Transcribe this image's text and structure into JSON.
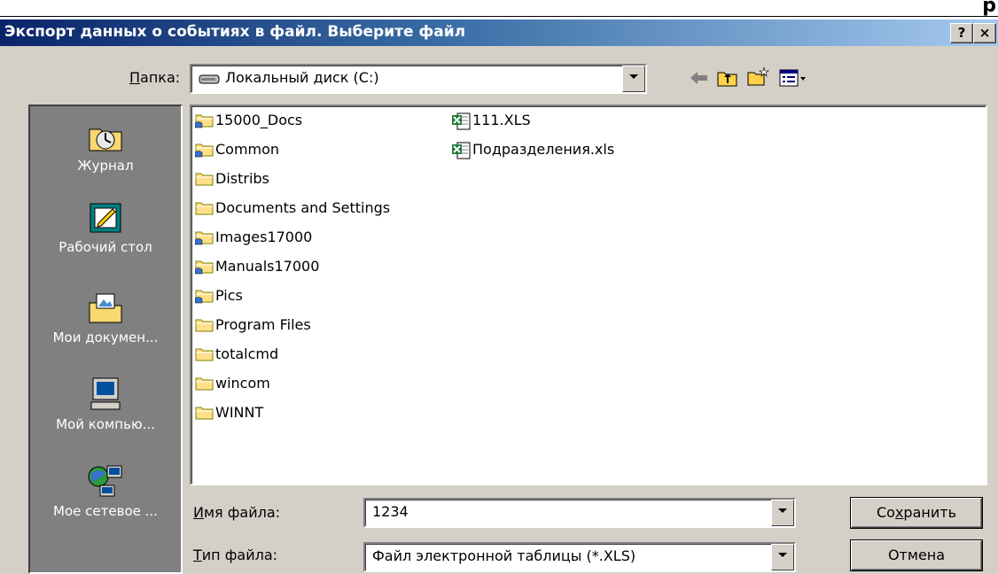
{
  "dialog": {
    "title": "Экспорт данных о событиях в файл. Выберите файл",
    "help_button": "?",
    "close_button": "×"
  },
  "page_fragment": "р",
  "look_in": {
    "label_ul": "П",
    "label_rest": "апка:",
    "value": "Локальный диск (C:)"
  },
  "toolbar": {
    "back_icon": "back-arrow-icon",
    "up_icon": "up-folder-icon",
    "new_folder_icon": "new-folder-icon",
    "view_icon": "view-menu-icon"
  },
  "places": [
    {
      "label": "Журнал",
      "icon": "history-icon"
    },
    {
      "label": "Рабочий стол",
      "icon": "desktop-icon"
    },
    {
      "label": "Мои докумен...",
      "icon": "my-documents-icon"
    },
    {
      "label": "Мой компью...",
      "icon": "my-computer-icon"
    },
    {
      "label": "Мое сетевое ...",
      "icon": "network-icon"
    }
  ],
  "files": {
    "col1": [
      {
        "name": "15000_Docs",
        "type": "shared-folder"
      },
      {
        "name": "Common",
        "type": "shared-folder"
      },
      {
        "name": "Distribs",
        "type": "folder"
      },
      {
        "name": "Documents and Settings",
        "type": "folder"
      },
      {
        "name": "Images17000",
        "type": "shared-folder"
      },
      {
        "name": "Manuals17000",
        "type": "shared-folder"
      },
      {
        "name": "Pics",
        "type": "shared-folder"
      },
      {
        "name": "Program Files",
        "type": "folder"
      },
      {
        "name": "totalcmd",
        "type": "folder"
      },
      {
        "name": "wincom",
        "type": "folder"
      },
      {
        "name": "WINNT",
        "type": "folder"
      }
    ],
    "col2": [
      {
        "name": "111.XLS",
        "type": "excel-file"
      },
      {
        "name": "Подразделения.xls",
        "type": "excel-file"
      }
    ]
  },
  "filename": {
    "label_ul": "И",
    "label_rest": "мя файла:",
    "value": "1234"
  },
  "filetype": {
    "label_ul": "Т",
    "label_rest": "ип файла:",
    "value": "Файл электронной таблицы (*.XLS)"
  },
  "buttons": {
    "save_pre": "Со",
    "save_ul": "х",
    "save_post": "ранить",
    "cancel": "Отмена"
  },
  "colors": {
    "title_start": "#0a246a",
    "title_end": "#a6caf0",
    "face": "#d4d0c8",
    "places_bg": "#808080"
  }
}
